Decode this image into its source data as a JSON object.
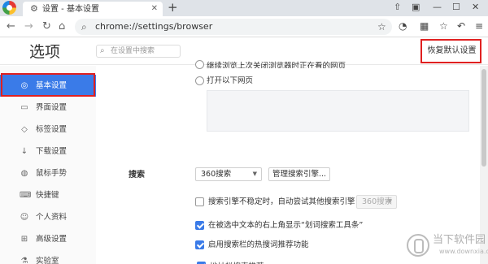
{
  "browser": {
    "tab": {
      "title": "设置 - 基本设置",
      "icon": "gear-icon"
    },
    "address": {
      "url": "chrome://settings/browser"
    }
  },
  "header": {
    "title": "选项",
    "search_placeholder": "在设置中搜索",
    "restore_label": "恢复默认设置"
  },
  "sidebar": {
    "items": [
      {
        "label": "基本设置",
        "icon": "settings-circle-icon",
        "active": true
      },
      {
        "label": "界面设置",
        "icon": "window-icon"
      },
      {
        "label": "标签设置",
        "icon": "tag-icon"
      },
      {
        "label": "下载设置",
        "icon": "download-icon"
      },
      {
        "label": "鼠标手势",
        "icon": "mouse-icon"
      },
      {
        "label": "快捷键",
        "icon": "keyboard-icon"
      },
      {
        "label": "个人资料",
        "icon": "user-icon"
      },
      {
        "label": "高级设置",
        "icon": "advanced-icon"
      },
      {
        "label": "实验室",
        "icon": "flask-icon"
      }
    ]
  },
  "startup": {
    "option_partial": "继续浏览上次关闭浏览器时正在看的网页",
    "open_pages_label": "打开以下网页"
  },
  "search": {
    "section_title": "搜索",
    "engine_value": "360搜索",
    "manage_button": "管理搜索引擎...",
    "unstable_label": "搜索引擎不稳定时，自动尝试其他搜索引擎：",
    "fallback_engine": "360搜索",
    "toolbar_label": "在被选中文本的右上角显示“划词搜索工具条”",
    "hot_words_label": "启用搜索栏的热搜词推荐功能",
    "partial_label": "地址栏搜索推荐"
  },
  "watermark": {
    "name": "当下软件园",
    "domain": "www.downxia.com"
  },
  "colors": {
    "accent": "#3a7be8",
    "highlight": "#e02020"
  }
}
